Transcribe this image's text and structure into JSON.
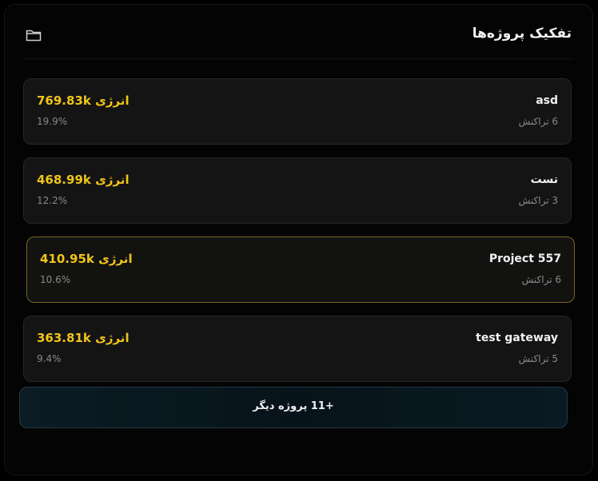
{
  "header": {
    "title": "تفکیک پروژه‌ها",
    "icon": "folder-icon"
  },
  "projects": [
    {
      "name": "asd",
      "transactions": "6 تراکنش",
      "energy": "769.83k انرژی",
      "percent": "19.9%"
    },
    {
      "name": "تست",
      "transactions": "3 تراکنش",
      "energy": "468.99k انرژی",
      "percent": "12.2%"
    },
    {
      "name": "Project 557",
      "transactions": "6 تراکنش",
      "energy": "410.95k انرژی",
      "percent": "10.6%"
    },
    {
      "name": "test gateway",
      "transactions": "5 تراکنش",
      "energy": "363.81k انرژی",
      "percent": "9.4%"
    }
  ],
  "more_button": {
    "label": "+11 پروژه دیگر"
  },
  "colors": {
    "accent": "#f0c419",
    "highlight_border": "#7a6520",
    "more_border": "#213844"
  }
}
